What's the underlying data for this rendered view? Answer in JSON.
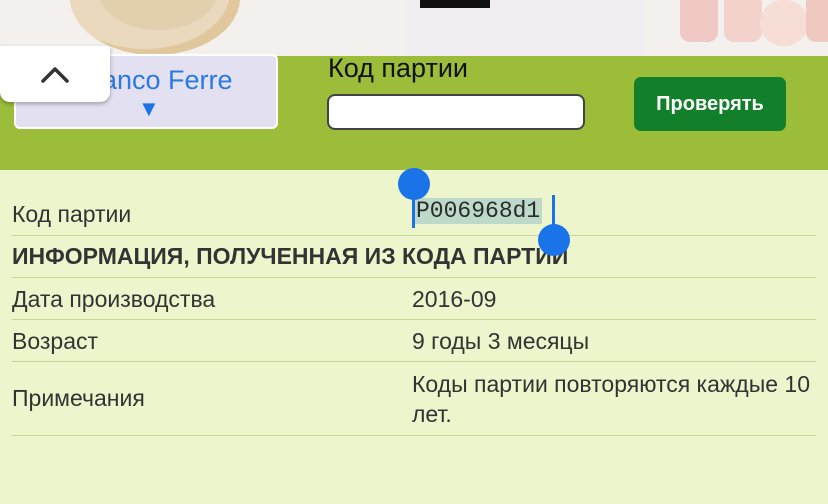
{
  "toolbar": {
    "brand_value": "anco Ferre",
    "brand_caret": "▼",
    "code_label": "Код партии",
    "code_input_value": "",
    "check_button": "Проверять"
  },
  "results": {
    "code_label": "Код партии",
    "code_value": "P006968d1",
    "section_heading": "ИНФОРМАЦИЯ, ПОЛУЧЕННАЯ ИЗ КОДА ПАРТИИ",
    "production_date_label": "Дата производства",
    "production_date_value": "2016-09",
    "age_label": "Возраст",
    "age_value": "9 годы 3 месяцы",
    "notes_label": "Примечания",
    "notes_value": "Коды партии повторяются каждые 10 лет."
  },
  "icons": {
    "collapse": "chevron-up-icon"
  },
  "colors": {
    "toolbar_bg": "#9bbd3a",
    "page_bg": "#edf5cd",
    "button_bg": "#127f2b",
    "selection": "#1a73e8"
  }
}
